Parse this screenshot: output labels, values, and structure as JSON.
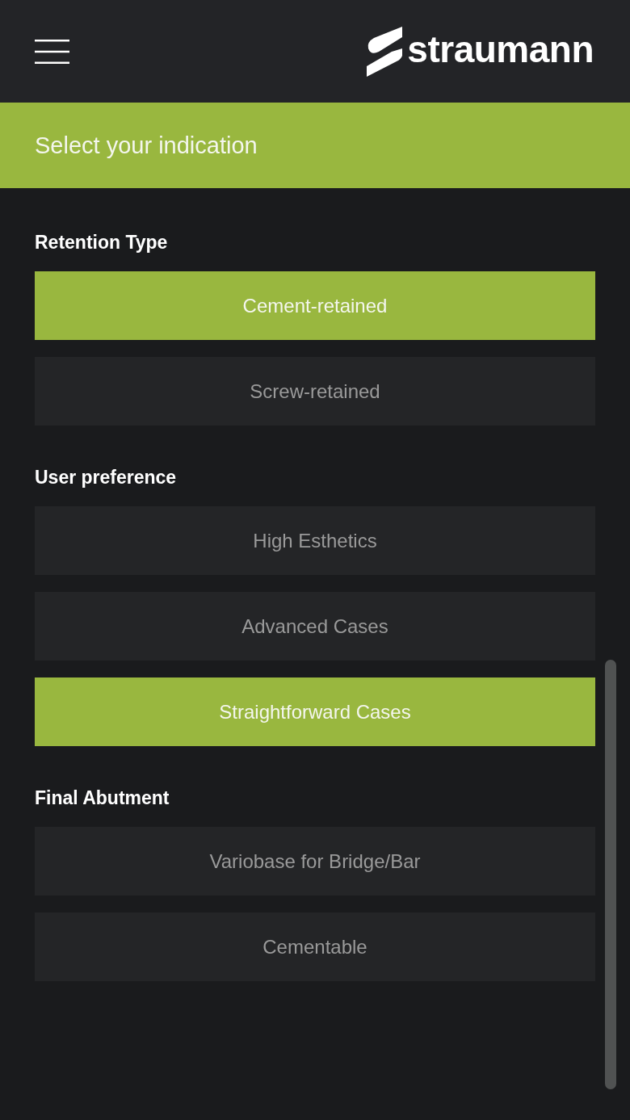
{
  "logo": {
    "text": "straumann"
  },
  "banner": {
    "title": "Select your indication"
  },
  "sections": [
    {
      "title": "Retention Type",
      "options": [
        {
          "label": "Cement-retained",
          "selected": true
        },
        {
          "label": "Screw-retained",
          "selected": false
        }
      ]
    },
    {
      "title": "User preference",
      "options": [
        {
          "label": "High Esthetics",
          "selected": false
        },
        {
          "label": "Advanced Cases",
          "selected": false
        },
        {
          "label": "Straightforward Cases",
          "selected": true
        }
      ]
    },
    {
      "title": "Final Abutment",
      "options": [
        {
          "label": "Variobase for Bridge/Bar",
          "selected": false
        },
        {
          "label": "Cementable",
          "selected": false
        }
      ]
    }
  ]
}
